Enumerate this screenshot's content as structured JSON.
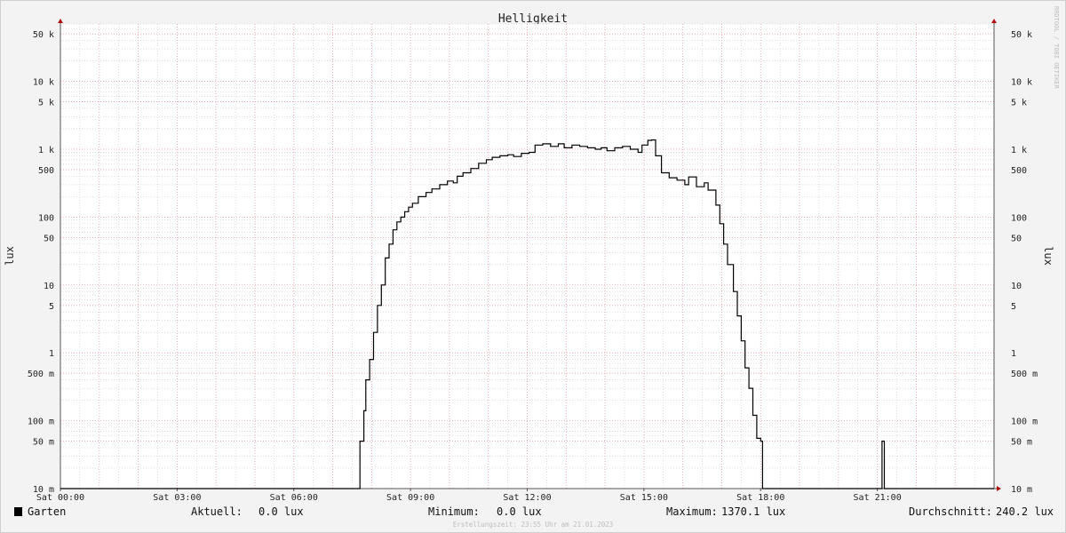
{
  "chart_data": {
    "type": "line",
    "title": "Helligkeit",
    "ylabel": "lux",
    "ylabel_right": "lux",
    "yscale": "log",
    "ylim": [
      0.01,
      70000
    ],
    "x_start": "Sat 00:00",
    "x_end": "Sun 00:00",
    "xlim_hours": [
      0,
      24
    ],
    "x_ticks": [
      {
        "h": 0,
        "label": "Sat 00:00"
      },
      {
        "h": 3,
        "label": "Sat 03:00"
      },
      {
        "h": 6,
        "label": "Sat 06:00"
      },
      {
        "h": 9,
        "label": "Sat 09:00"
      },
      {
        "h": 12,
        "label": "Sat 12:00"
      },
      {
        "h": 15,
        "label": "Sat 15:00"
      },
      {
        "h": 18,
        "label": "Sat 18:00"
      },
      {
        "h": 21,
        "label": "Sat 21:00"
      }
    ],
    "y_ticks": [
      {
        "v": 0.01,
        "label": "10 m"
      },
      {
        "v": 0.05,
        "label": "50 m"
      },
      {
        "v": 0.1,
        "label": "100 m"
      },
      {
        "v": 0.5,
        "label": "500 m"
      },
      {
        "v": 1,
        "label": "1"
      },
      {
        "v": 5,
        "label": "5"
      },
      {
        "v": 10,
        "label": "10"
      },
      {
        "v": 50,
        "label": "50"
      },
      {
        "v": 100,
        "label": "100"
      },
      {
        "v": 500,
        "label": "500"
      },
      {
        "v": 1000,
        "label": "1 k"
      },
      {
        "v": 5000,
        "label": "5 k"
      },
      {
        "v": 10000,
        "label": "10 k"
      },
      {
        "v": 50000,
        "label": "50 k"
      }
    ],
    "grid": true,
    "series": [
      {
        "name": "Garten",
        "color": "#000000",
        "step": true,
        "points": [
          [
            0,
            0.01
          ],
          [
            7.65,
            0.01
          ],
          [
            7.7,
            0.05
          ],
          [
            7.8,
            0.14
          ],
          [
            7.85,
            0.4
          ],
          [
            7.95,
            0.8
          ],
          [
            8.05,
            2
          ],
          [
            8.15,
            5
          ],
          [
            8.25,
            10
          ],
          [
            8.35,
            25
          ],
          [
            8.45,
            40
          ],
          [
            8.55,
            65
          ],
          [
            8.65,
            85
          ],
          [
            8.75,
            100
          ],
          [
            8.85,
            120
          ],
          [
            8.95,
            140
          ],
          [
            9.05,
            160
          ],
          [
            9.2,
            200
          ],
          [
            9.4,
            230
          ],
          [
            9.55,
            260
          ],
          [
            9.75,
            300
          ],
          [
            9.95,
            340
          ],
          [
            10.1,
            320
          ],
          [
            10.2,
            400
          ],
          [
            10.35,
            450
          ],
          [
            10.55,
            520
          ],
          [
            10.75,
            620
          ],
          [
            10.95,
            700
          ],
          [
            11.1,
            760
          ],
          [
            11.3,
            800
          ],
          [
            11.5,
            830
          ],
          [
            11.65,
            780
          ],
          [
            11.85,
            870
          ],
          [
            12.05,
            900
          ],
          [
            12.2,
            1150
          ],
          [
            12.4,
            1200
          ],
          [
            12.6,
            1100
          ],
          [
            12.8,
            1200
          ],
          [
            12.95,
            1050
          ],
          [
            13.15,
            1150
          ],
          [
            13.35,
            1100
          ],
          [
            13.55,
            1050
          ],
          [
            13.75,
            1000
          ],
          [
            13.9,
            1050
          ],
          [
            14.05,
            950
          ],
          [
            14.25,
            1050
          ],
          [
            14.45,
            1100
          ],
          [
            14.65,
            1000
          ],
          [
            14.85,
            900
          ],
          [
            14.95,
            1150
          ],
          [
            15.1,
            1350
          ],
          [
            15.2,
            1370
          ],
          [
            15.3,
            800
          ],
          [
            15.45,
            450
          ],
          [
            15.65,
            380
          ],
          [
            15.85,
            350
          ],
          [
            16.05,
            300
          ],
          [
            16.15,
            390
          ],
          [
            16.35,
            280
          ],
          [
            16.55,
            320
          ],
          [
            16.65,
            250
          ],
          [
            16.85,
            150
          ],
          [
            16.95,
            80
          ],
          [
            17.05,
            40
          ],
          [
            17.15,
            20
          ],
          [
            17.3,
            8
          ],
          [
            17.4,
            3.5
          ],
          [
            17.5,
            1.5
          ],
          [
            17.6,
            0.6
          ],
          [
            17.7,
            0.3
          ],
          [
            17.8,
            0.12
          ],
          [
            17.9,
            0.055
          ],
          [
            18.0,
            0.05
          ],
          [
            18.05,
            0.01
          ],
          [
            21.1,
            0.01
          ],
          [
            21.12,
            0.05
          ],
          [
            21.18,
            0.01
          ],
          [
            24,
            0.01
          ]
        ]
      }
    ]
  },
  "legend": {
    "items": [
      {
        "name": "Garten",
        "color": "#000000"
      }
    ],
    "current_label": "Aktuell:",
    "current_value": "0.0 lux",
    "min_label": "Minimum:",
    "min_value": "0.0 lux",
    "max_label": "Maximum:",
    "max_value": "1370.1 lux",
    "avg_label": "Durchschnitt:",
    "avg_value": "240.2 lux"
  },
  "watermark": "RRDTOOL / TOBI OETIKER",
  "footer": "Erstellungszeit: 23:55 Uhr am 21.01.2023",
  "colors": {
    "background": "#f3f3f3",
    "plot_area": "#ffffff",
    "major_grid": "#e8a0a8",
    "minor_grid": "#c8c8c8",
    "axis": "#555555",
    "arrow": "#b01010"
  }
}
